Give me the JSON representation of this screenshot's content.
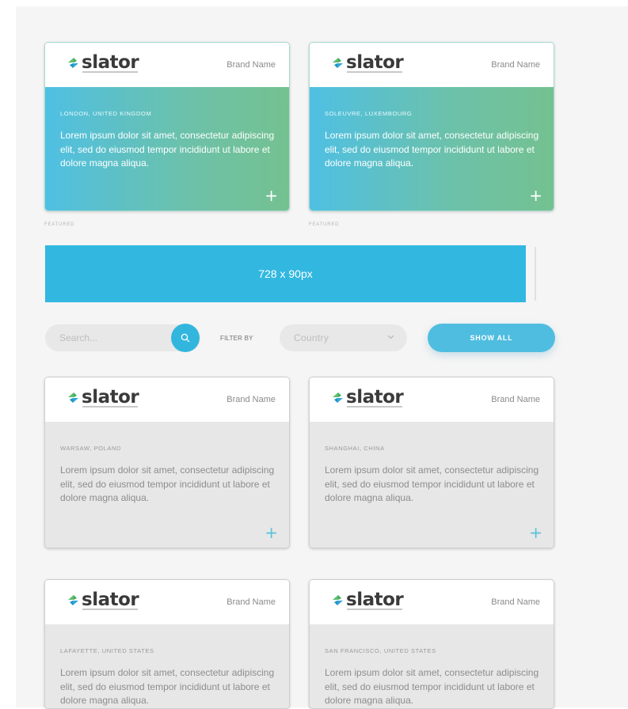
{
  "featured_cards": [
    {
      "brand": "Brand Name",
      "logo_text": "slator",
      "location": "LONDON, UNITED KINGDOM",
      "description": "Lorem ipsum dolor sit amet, consectetur adipiscing elit, sed do eiusmod tempor incididunt ut labore et dolore magna aliqua.",
      "badge": "FEATURED"
    },
    {
      "brand": "Brand Name",
      "logo_text": "slator",
      "location": "SOLEUVRE, LUXEMBOURG",
      "description": "Lorem ipsum dolor sit amet, consectetur adipiscing elit, sed do eiusmod tempor incididunt ut labore et dolore magna aliqua.",
      "badge": "FEATURED"
    }
  ],
  "ad": {
    "label": "728 x 90px"
  },
  "filters": {
    "search_placeholder": "Search...",
    "filter_label": "FILTER BY",
    "country_value": "Country",
    "show_all_label": "SHOW ALL"
  },
  "cards": [
    {
      "brand": "Brand Name",
      "logo_text": "slator",
      "location": "WARSAW, POLAND",
      "description": "Lorem ipsum dolor sit amet, consectetur adipiscing elit, sed do eiusmod tempor incididunt ut labore et dolore magna aliqua."
    },
    {
      "brand": "Brand Name",
      "logo_text": "slator",
      "location": "SHANGHAI, CHINA",
      "description": "Lorem ipsum dolor sit amet, consectetur adipiscing elit, sed do eiusmod tempor incididunt ut labore et dolore magna aliqua."
    },
    {
      "brand": "Brand Name",
      "logo_text": "slator",
      "location": "LAFAYETTE, UNITED STATES",
      "description": "Lorem ipsum dolor sit amet, consectetur adipiscing elit, sed do eiusmod tempor incididunt ut labore et dolore magna aliqua."
    },
    {
      "brand": "Brand Name",
      "logo_text": "slator",
      "location": "SAN FRANCISCO, UNITED STATES",
      "description": "Lorem ipsum dolor sit amet, consectetur adipiscing elit, sed do eiusmod tempor incididunt ut labore et dolore magna aliqua."
    }
  ],
  "icons": {
    "expand": "plus-icon",
    "search": "search-icon",
    "dropdown": "chevron-down-icon",
    "logo": "slator-logo-icon"
  },
  "colors": {
    "accent": "#32b8e0",
    "gradient_start": "#4fc0e3",
    "gradient_end": "#74c190",
    "card_gray": "#e7e7e7"
  }
}
